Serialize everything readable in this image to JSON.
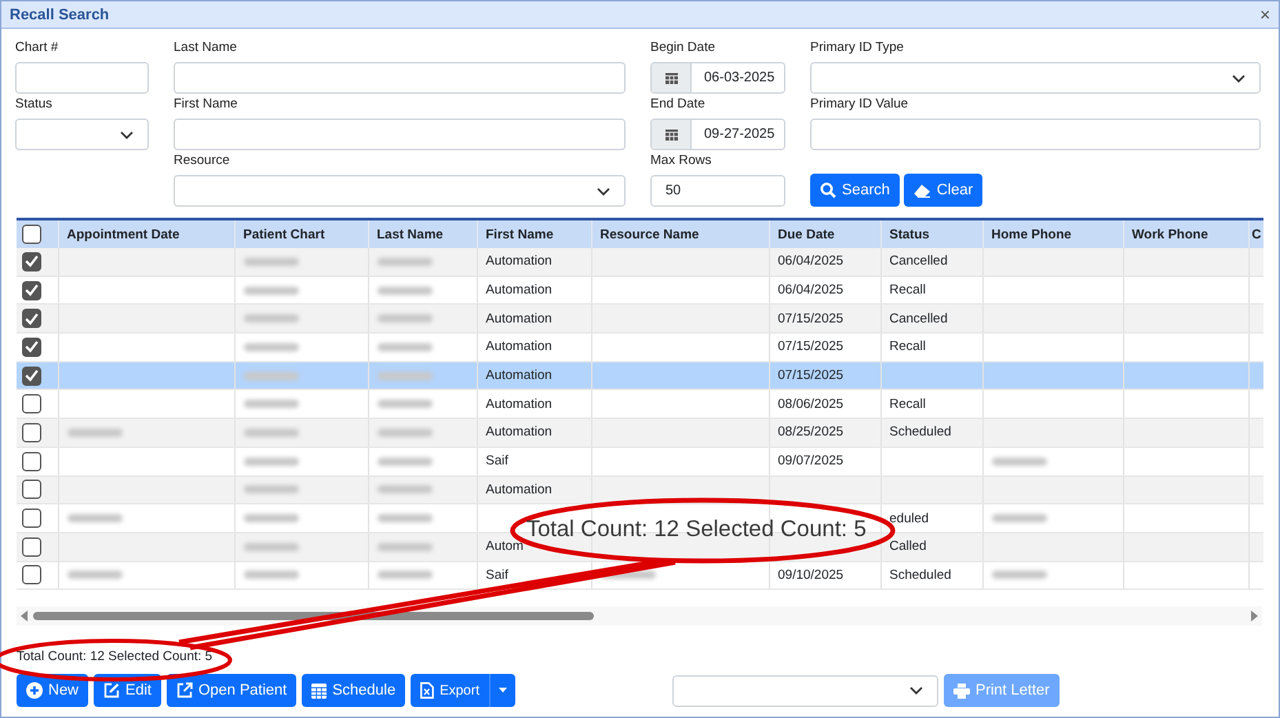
{
  "window": {
    "title": "Recall Search",
    "close": "×"
  },
  "form": {
    "rows": [
      {
        "fields": [
          {
            "kind": "text",
            "label": "Chart #"
          },
          {
            "kind": "text",
            "label": "Last Name"
          },
          {
            "kind": "date",
            "label": "Begin Date",
            "value": "06-03-2025"
          },
          {
            "kind": "select",
            "label": "Primary ID Type"
          }
        ]
      },
      {
        "fields": [
          {
            "kind": "select",
            "label": "Status"
          },
          {
            "kind": "text",
            "label": "First Name"
          },
          {
            "kind": "date",
            "label": "End Date",
            "value": "09-27-2025"
          },
          {
            "kind": "text",
            "label": "Primary ID Value"
          }
        ]
      },
      {
        "fields": [
          {
            "kind": "select",
            "label": "Resource"
          },
          {
            "kind": "text",
            "label": "Max Rows",
            "value": "50"
          }
        ],
        "actions": [
          {
            "label": "Search"
          },
          {
            "label": "Clear"
          }
        ]
      }
    ]
  },
  "table": {
    "header_checked": false,
    "columns": [
      "Appointment Date",
      "Patient Chart",
      "Last Name",
      "First Name",
      "Resource Name",
      "Due Date",
      "Status",
      "Home Phone",
      "Work Phone",
      "C"
    ],
    "rows": [
      {
        "checked": true,
        "selected": false,
        "cells": [
          null,
          {
            "kind": "blurred"
          },
          {
            "kind": "blurred"
          },
          "Automation",
          null,
          "06/04/2025",
          "Cancelled",
          null,
          null
        ]
      },
      {
        "checked": true,
        "selected": false,
        "cells": [
          null,
          {
            "kind": "blurred"
          },
          {
            "kind": "blurred"
          },
          "Automation",
          null,
          "06/04/2025",
          "Recall",
          null,
          null
        ]
      },
      {
        "checked": true,
        "selected": false,
        "cells": [
          null,
          {
            "kind": "blurred"
          },
          {
            "kind": "blurred"
          },
          "Automation",
          null,
          "07/15/2025",
          "Cancelled",
          null,
          null
        ]
      },
      {
        "checked": true,
        "selected": false,
        "cells": [
          null,
          {
            "kind": "blurred"
          },
          {
            "kind": "blurred"
          },
          "Automation",
          null,
          "07/15/2025",
          "Recall",
          null,
          null
        ]
      },
      {
        "checked": true,
        "selected": true,
        "cells": [
          null,
          {
            "kind": "blurred"
          },
          {
            "kind": "blurred"
          },
          "Automation",
          null,
          "07/15/2025",
          null,
          null,
          null
        ]
      },
      {
        "checked": false,
        "selected": false,
        "cells": [
          null,
          {
            "kind": "blurred"
          },
          {
            "kind": "blurred"
          },
          "Automation",
          null,
          "08/06/2025",
          "Recall",
          null,
          null
        ]
      },
      {
        "checked": false,
        "selected": false,
        "cells": [
          {
            "kind": "blurred"
          },
          {
            "kind": "blurred"
          },
          {
            "kind": "blurred"
          },
          "Automation",
          null,
          "08/25/2025",
          "Scheduled",
          null,
          null
        ]
      },
      {
        "checked": false,
        "selected": false,
        "cells": [
          null,
          {
            "kind": "blurred"
          },
          {
            "kind": "blurred"
          },
          "Saif",
          null,
          "09/07/2025",
          null,
          {
            "kind": "blurred"
          },
          null
        ]
      },
      {
        "checked": false,
        "selected": false,
        "cells": [
          null,
          {
            "kind": "blurred"
          },
          {
            "kind": "blurred"
          },
          "Automation",
          null,
          null,
          null,
          null,
          null
        ]
      },
      {
        "checked": false,
        "selected": false,
        "cells": [
          {
            "kind": "blurred"
          },
          {
            "kind": "blurred"
          },
          {
            "kind": "blurred"
          },
          null,
          null,
          null,
          "eduled",
          {
            "kind": "blurred"
          },
          null
        ]
      },
      {
        "checked": false,
        "selected": false,
        "cells": [
          null,
          {
            "kind": "blurred"
          },
          {
            "kind": "blurred"
          },
          "Autom",
          null,
          null,
          "Called",
          null,
          null
        ]
      },
      {
        "checked": false,
        "selected": false,
        "cells": [
          {
            "kind": "blurred"
          },
          {
            "kind": "blurred"
          },
          {
            "kind": "blurred"
          },
          "Saif",
          {
            "kind": "blurred"
          },
          "09/10/2025",
          "Scheduled",
          {
            "kind": "blurred"
          },
          null
        ]
      }
    ]
  },
  "status_text": "Total Count: 12 Selected Count: 5",
  "callout": {
    "text": "Total Count: 12 Selected Count: 5"
  },
  "footer": {
    "buttons": [
      {
        "label": "New"
      },
      {
        "label": "Edit"
      },
      {
        "label": "Open Patient"
      },
      {
        "label": "Schedule"
      },
      {
        "label": "Export",
        "kind": "split"
      }
    ],
    "letter_select": {
      "kind": "select"
    },
    "print_button": {
      "label": "Print Letter",
      "disabled": true
    }
  }
}
